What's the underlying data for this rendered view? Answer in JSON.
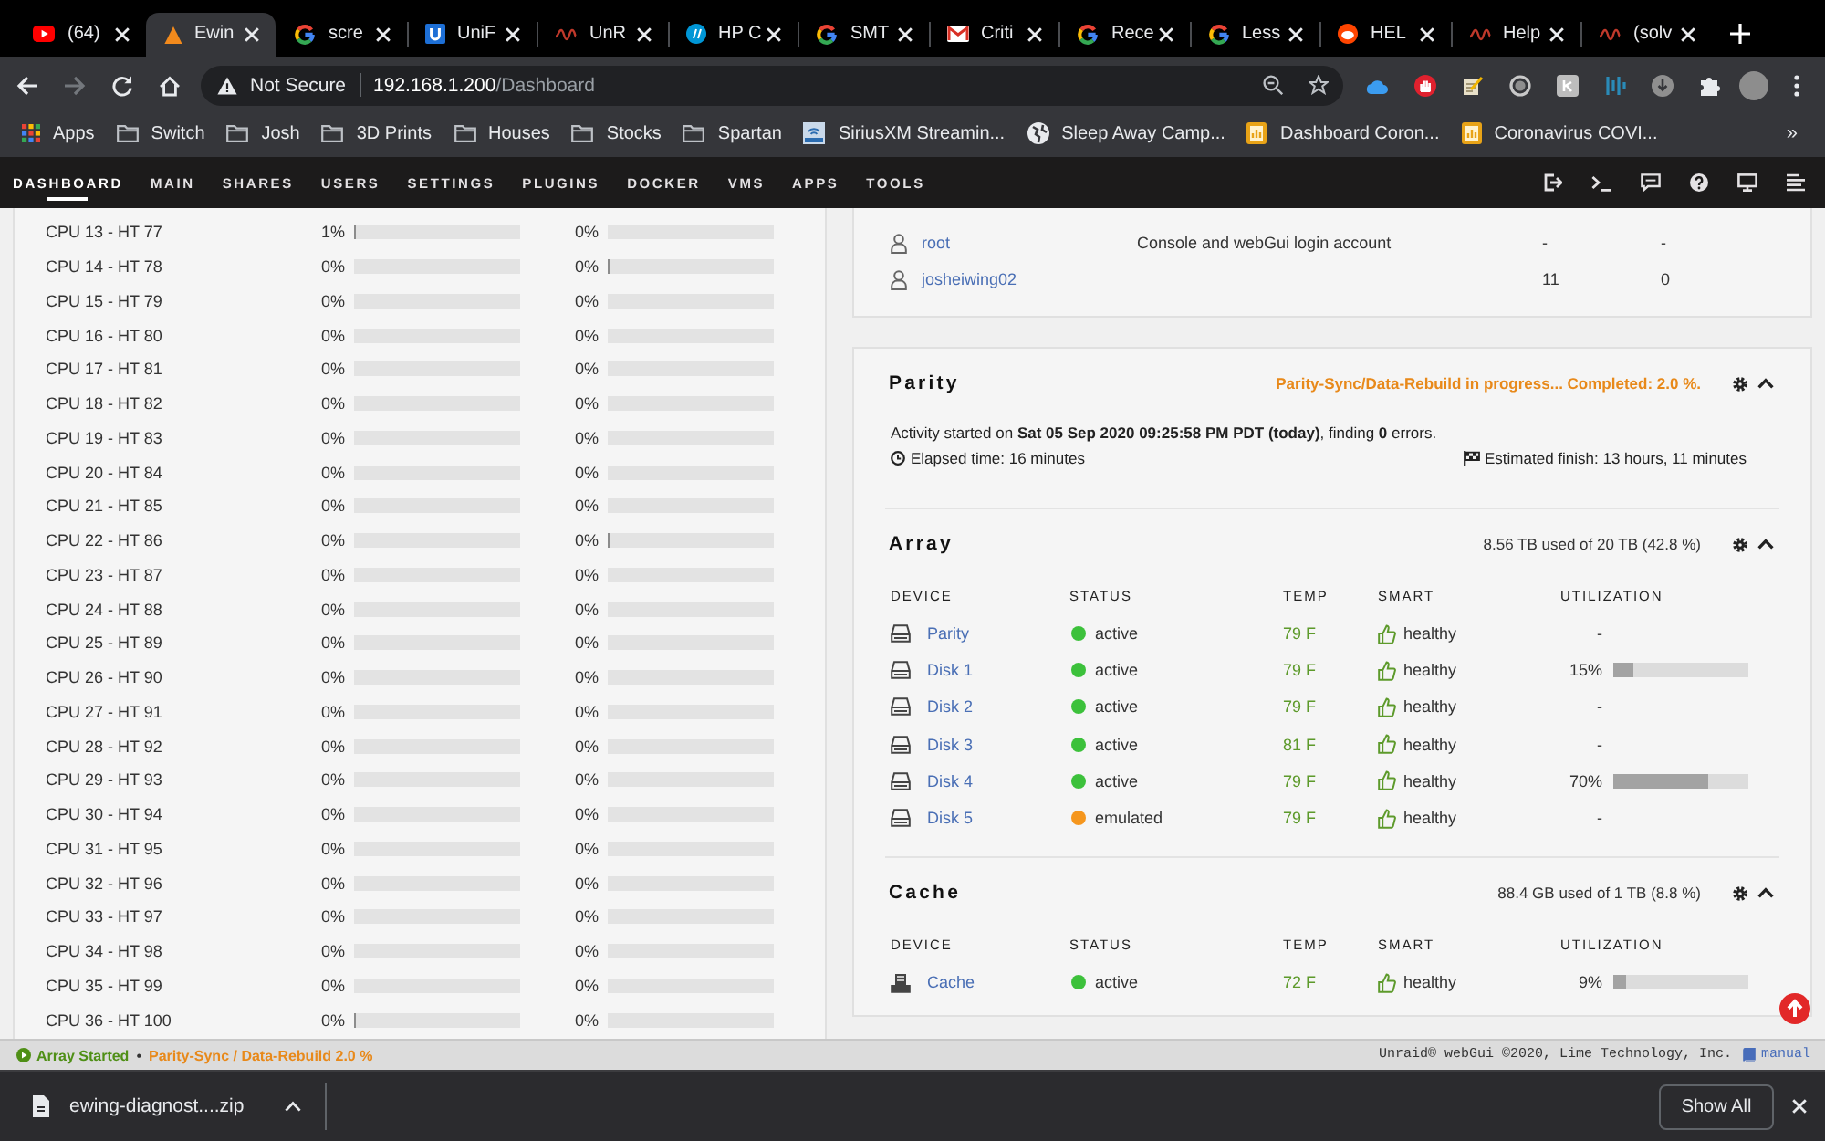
{
  "browser": {
    "tabs": [
      {
        "title": "(64)",
        "kind": "play",
        "selected": false
      },
      {
        "title": "Ewin",
        "kind": "triangle",
        "selected": true
      },
      {
        "title": "scre",
        "kind": "ring",
        "selected": false
      },
      {
        "title": "UniF",
        "kind": "tile",
        "selected": false
      },
      {
        "title": "UnR",
        "kind": "wave",
        "selected": false
      },
      {
        "title": "HP C",
        "kind": "disc",
        "selected": false
      },
      {
        "title": "SMT",
        "kind": "ring",
        "selected": false
      },
      {
        "title": "Criti",
        "kind": "envelope",
        "selected": false
      },
      {
        "title": "Rece",
        "kind": "ring",
        "selected": false
      },
      {
        "title": "Less",
        "kind": "ring",
        "selected": false
      },
      {
        "title": "HEL",
        "kind": "face",
        "selected": false
      },
      {
        "title": "Help",
        "kind": "wave",
        "selected": false
      },
      {
        "title": "(solv",
        "kind": "wave",
        "selected": false
      }
    ],
    "address_bar": {
      "security": "Not Secure",
      "host": "192.168.1.200",
      "path": "/Dashboard"
    },
    "bookmarks": [
      {
        "label": "Apps",
        "kind": "apps"
      },
      {
        "label": "Switch",
        "kind": "folder"
      },
      {
        "label": "Josh",
        "kind": "folder"
      },
      {
        "label": "3D Prints",
        "kind": "folder"
      },
      {
        "label": "Houses",
        "kind": "folder"
      },
      {
        "label": "Stocks",
        "kind": "folder"
      },
      {
        "label": "Spartan",
        "kind": "folder"
      },
      {
        "label": "SiriusXM Streamin...",
        "kind": "tile"
      },
      {
        "label": "Sleep Away Camp...",
        "kind": "globe"
      },
      {
        "label": "Dashboard Coron...",
        "kind": "chart"
      },
      {
        "label": "Coronavirus COVI...",
        "kind": "chart"
      }
    ],
    "bookmarks_more": "»"
  },
  "nav": {
    "items": [
      {
        "label": "DASHBOARD",
        "selected": true
      },
      {
        "label": "MAIN",
        "selected": false
      },
      {
        "label": "SHARES",
        "selected": false
      },
      {
        "label": "USERS",
        "selected": false
      },
      {
        "label": "SETTINGS",
        "selected": false
      },
      {
        "label": "PLUGINS",
        "selected": false
      },
      {
        "label": "DOCKER",
        "selected": false
      },
      {
        "label": "VMS",
        "selected": false
      },
      {
        "label": "APPS",
        "selected": false
      },
      {
        "label": "TOOLS",
        "selected": false
      }
    ]
  },
  "cpu_panel": {
    "rows": [
      {
        "label": "CPU 13 - HT 77",
        "cores": [
          {
            "reading": "1%",
            "level": 0.01
          },
          {
            "reading": "0%",
            "level": 0
          }
        ]
      },
      {
        "label": "CPU 14 - HT 78",
        "cores": [
          {
            "reading": "0%",
            "level": 0
          },
          {
            "reading": "0%",
            "level": 0.01
          }
        ]
      },
      {
        "label": "CPU 15 - HT 79",
        "cores": [
          {
            "reading": "0%",
            "level": 0
          },
          {
            "reading": "0%",
            "level": 0
          }
        ]
      },
      {
        "label": "CPU 16 - HT 80",
        "cores": [
          {
            "reading": "0%",
            "level": 0
          },
          {
            "reading": "0%",
            "level": 0
          }
        ]
      },
      {
        "label": "CPU 17 - HT 81",
        "cores": [
          {
            "reading": "0%",
            "level": 0
          },
          {
            "reading": "0%",
            "level": 0
          }
        ]
      },
      {
        "label": "CPU 18 - HT 82",
        "cores": [
          {
            "reading": "0%",
            "level": 0
          },
          {
            "reading": "0%",
            "level": 0
          }
        ]
      },
      {
        "label": "CPU 19 - HT 83",
        "cores": [
          {
            "reading": "0%",
            "level": 0
          },
          {
            "reading": "0%",
            "level": 0
          }
        ]
      },
      {
        "label": "CPU 20 - HT 84",
        "cores": [
          {
            "reading": "0%",
            "level": 0
          },
          {
            "reading": "0%",
            "level": 0
          }
        ]
      },
      {
        "label": "CPU 21 - HT 85",
        "cores": [
          {
            "reading": "0%",
            "level": 0
          },
          {
            "reading": "0%",
            "level": 0
          }
        ]
      },
      {
        "label": "CPU 22 - HT 86",
        "cores": [
          {
            "reading": "0%",
            "level": 0
          },
          {
            "reading": "0%",
            "level": 0.01
          }
        ]
      },
      {
        "label": "CPU 23 - HT 87",
        "cores": [
          {
            "reading": "0%",
            "level": 0
          },
          {
            "reading": "0%",
            "level": 0
          }
        ]
      },
      {
        "label": "CPU 24 - HT 88",
        "cores": [
          {
            "reading": "0%",
            "level": 0
          },
          {
            "reading": "0%",
            "level": 0
          }
        ]
      },
      {
        "label": "CPU 25 - HT 89",
        "cores": [
          {
            "reading": "0%",
            "level": 0
          },
          {
            "reading": "0%",
            "level": 0
          }
        ]
      },
      {
        "label": "CPU 26 - HT 90",
        "cores": [
          {
            "reading": "0%",
            "level": 0
          },
          {
            "reading": "0%",
            "level": 0
          }
        ]
      },
      {
        "label": "CPU 27 - HT 91",
        "cores": [
          {
            "reading": "0%",
            "level": 0
          },
          {
            "reading": "0%",
            "level": 0
          }
        ]
      },
      {
        "label": "CPU 28 - HT 92",
        "cores": [
          {
            "reading": "0%",
            "level": 0
          },
          {
            "reading": "0%",
            "level": 0
          }
        ]
      },
      {
        "label": "CPU 29 - HT 93",
        "cores": [
          {
            "reading": "0%",
            "level": 0
          },
          {
            "reading": "0%",
            "level": 0
          }
        ]
      },
      {
        "label": "CPU 30 - HT 94",
        "cores": [
          {
            "reading": "0%",
            "level": 0
          },
          {
            "reading": "0%",
            "level": 0
          }
        ]
      },
      {
        "label": "CPU 31 - HT 95",
        "cores": [
          {
            "reading": "0%",
            "level": 0
          },
          {
            "reading": "0%",
            "level": 0
          }
        ]
      },
      {
        "label": "CPU 32 - HT 96",
        "cores": [
          {
            "reading": "0%",
            "level": 0
          },
          {
            "reading": "0%",
            "level": 0
          }
        ]
      },
      {
        "label": "CPU 33 - HT 97",
        "cores": [
          {
            "reading": "0%",
            "level": 0
          },
          {
            "reading": "0%",
            "level": 0
          }
        ]
      },
      {
        "label": "CPU 34 - HT 98",
        "cores": [
          {
            "reading": "0%",
            "level": 0
          },
          {
            "reading": "0%",
            "level": 0
          }
        ]
      },
      {
        "label": "CPU 35 - HT 99",
        "cores": [
          {
            "reading": "0%",
            "level": 0
          },
          {
            "reading": "0%",
            "level": 0
          }
        ]
      },
      {
        "label": "CPU 36 - HT 100",
        "cores": [
          {
            "reading": "0%",
            "level": 0.01
          },
          {
            "reading": "0%",
            "level": 0
          }
        ]
      }
    ]
  },
  "users": {
    "rows": [
      {
        "column_1": "root",
        "column_2": "Console and webGui login account",
        "column_3": "-",
        "column_4": "-"
      },
      {
        "column_1": "josheiwing02",
        "column_3": "11",
        "column_4": "0"
      }
    ]
  },
  "parity": {
    "title": "Parity",
    "status": "Parity-Sync/Data-Rebuild in progress... Completed: 2.0 %.",
    "activity": "Activity started on **Sat 05 Sep 2020 09:25:58 PM PDT (today)**, finding **0** errors.",
    "elapsed": "Elapsed time: 16 minutes",
    "estimated": "Estimated finish: 13 hours, 11 minutes"
  },
  "disk_panels": [
    {
      "kind": "array",
      "title": "Array",
      "usage": "8.56 TB used of 20 TB (42.8 %)",
      "columns": [
        "DEVICE",
        "STATUS",
        "TEMP",
        "SMART",
        "UTILIZATION"
      ],
      "rows": [
        {
          "device": "Parity",
          "status": "active",
          "color": "#3cc13b",
          "temp": "79 F",
          "smart": "healthy",
          "utilization": "-"
        },
        {
          "device": "Disk 1",
          "status": "active",
          "color": "#3cc13b",
          "temp": "79 F",
          "smart": "healthy",
          "utilization": "15%",
          "level": 0.15
        },
        {
          "device": "Disk 2",
          "status": "active",
          "color": "#3cc13b",
          "temp": "79 F",
          "smart": "healthy",
          "utilization": "-"
        },
        {
          "device": "Disk 3",
          "status": "active",
          "color": "#3cc13b",
          "temp": "81 F",
          "smart": "healthy",
          "utilization": "-"
        },
        {
          "device": "Disk 4",
          "status": "active",
          "color": "#3cc13b",
          "temp": "79 F",
          "smart": "healthy",
          "utilization": "70%",
          "level": 0.7
        },
        {
          "device": "Disk 5",
          "status": "emulated",
          "color": "#f5961d",
          "temp": "79 F",
          "smart": "healthy",
          "utilization": "-"
        }
      ]
    },
    {
      "kind": "cache",
      "title": "Cache",
      "usage": "88.4 GB used of 1 TB (8.8 %)",
      "columns": [
        "DEVICE",
        "STATUS",
        "TEMP",
        "SMART",
        "UTILIZATION"
      ],
      "rows": [
        {
          "device": "Cache",
          "status": "active",
          "color": "#3cc13b",
          "temp": "72 F",
          "smart": "healthy",
          "utilization": "9%",
          "level": 0.09
        }
      ]
    }
  ],
  "status_bar": {
    "array_state": "Array Started",
    "separator": "•",
    "activity": "Parity-Sync / Data-Rebuild 2.0 %",
    "copyright": "Unraid® webGui ©2020, Lime Technology, Inc.",
    "manual": "manual"
  },
  "download_bar": {
    "file": "ewing-diagnost....zip",
    "show_all": "Show All"
  }
}
